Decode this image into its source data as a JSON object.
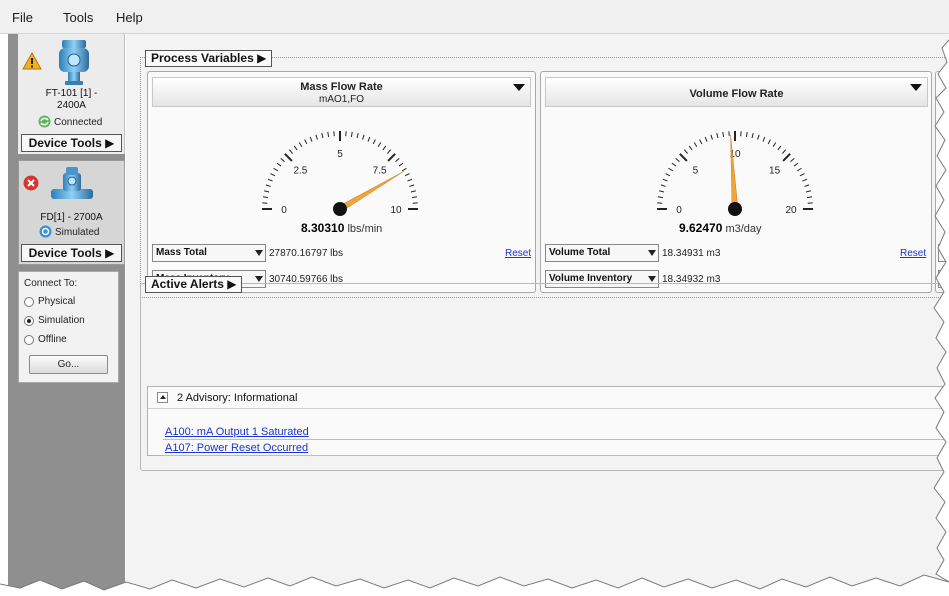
{
  "menu": [
    "File",
    "Tools",
    "Help"
  ],
  "sidebar": {
    "device1": {
      "name": "FT-101  [1] -\n2400A",
      "status": "Connected",
      "tools_label": "Device Tools ▶"
    },
    "device2": {
      "name": "FD[1] - 2700A",
      "status": "Simulated",
      "tools_label": "Device Tools ▶"
    },
    "connect": {
      "title": "Connect To:",
      "options": [
        "Physical",
        "Simulation",
        "Offline"
      ],
      "selected": "Simulation",
      "go_label": "Go..."
    }
  },
  "process_variables": {
    "label": "Process Variables ▶",
    "panels": [
      {
        "title": "Mass Flow Rate",
        "subtitle": "mAO1,FO",
        "gauge": {
          "min": 0,
          "max": 10,
          "ticks": [
            "0",
            "2.5",
            "5",
            "7.5",
            "10"
          ],
          "needle_value": 8.3031
        },
        "value": "8.30310",
        "unit": "lbs/min",
        "rows": [
          {
            "select": "Mass Total",
            "value": "27870.16797 lbs",
            "reset": "Reset"
          },
          {
            "select": "Mass Inventory",
            "value": "30740.59766 lbs"
          }
        ]
      },
      {
        "title": "Volume Flow Rate",
        "subtitle": "",
        "gauge": {
          "min": 0,
          "max": 20,
          "ticks": [
            "0",
            "5",
            "10",
            "15",
            "20"
          ],
          "needle_value": 9.6247
        },
        "value": "9.62470",
        "unit": "m3/day",
        "rows": [
          {
            "select": "Volume Total",
            "value": "18.34931 m3",
            "reset": "Reset"
          },
          {
            "select": "Volume Inventory",
            "value": "18.34932 m3"
          }
        ]
      }
    ],
    "partial_rows": [
      "D",
      "Te"
    ]
  },
  "active_alerts": {
    "label": "Active Alerts ▶",
    "group_title": "2 Advisory: Informational",
    "alerts": [
      "A100: mA Output 1 Saturated",
      "A107: Power Reset Occurred"
    ]
  },
  "colors": {
    "needle": "#f0a43a",
    "link": "#1a34d6",
    "sidebar": "#8f8f8f",
    "main_bg": "#f3f3f3"
  }
}
